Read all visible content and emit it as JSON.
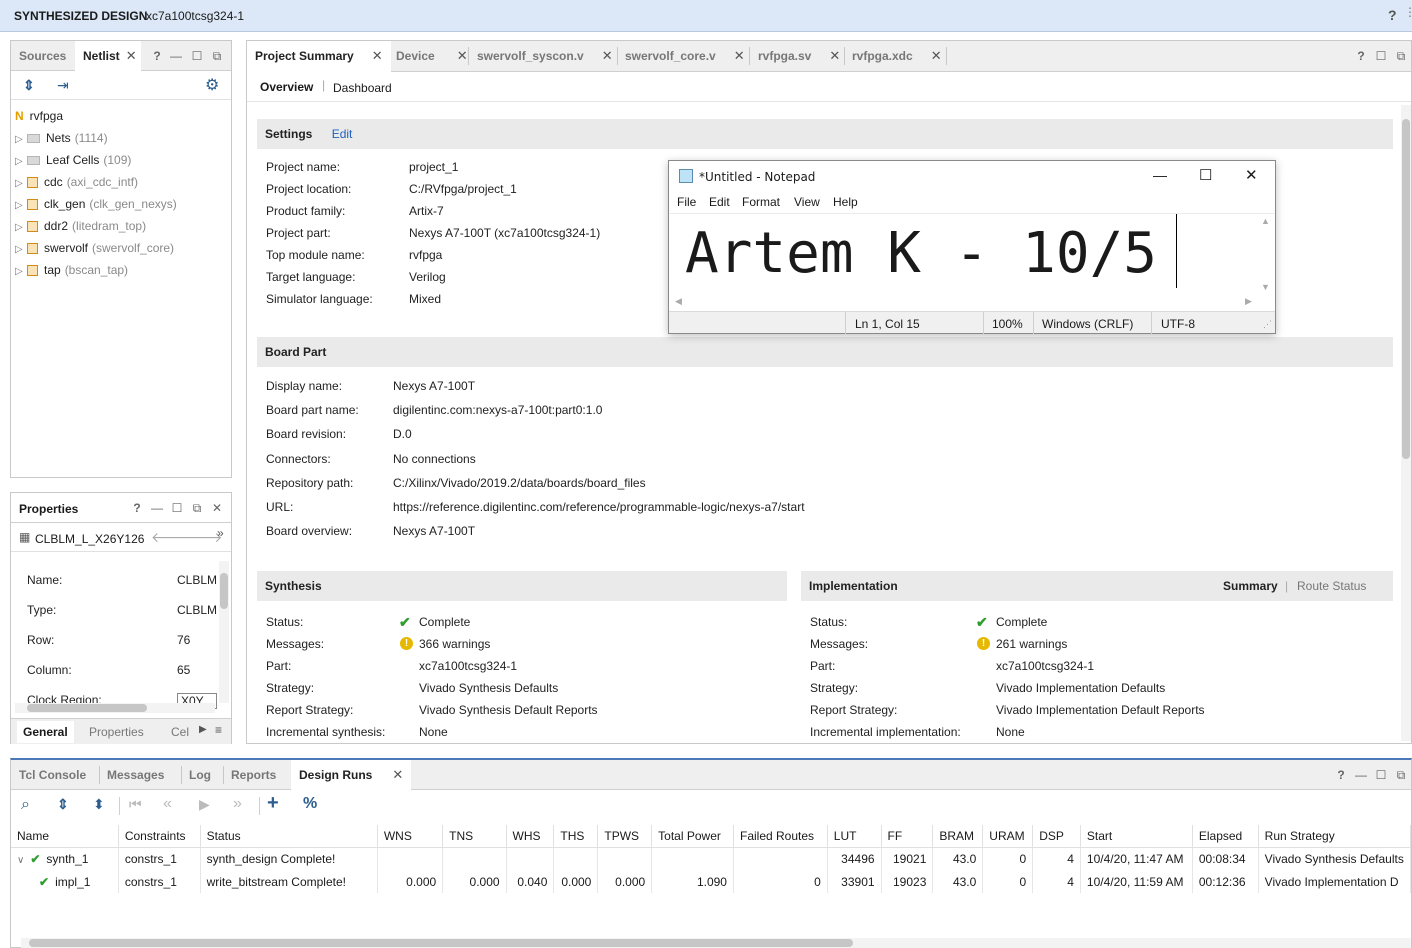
{
  "title_bar": {
    "title": "SYNTHESIZED DESIGN",
    "part": "xc7a100tcsg324-1",
    "help": "?"
  },
  "netlist_panel": {
    "tabs": [
      "Sources",
      "Netlist"
    ],
    "root": "rvfpga",
    "items": [
      {
        "name": "Nets",
        "extra": "(1114)",
        "kind": "folder"
      },
      {
        "name": "Leaf Cells",
        "extra": "(109)",
        "kind": "folder"
      },
      {
        "name": "cdc",
        "extra": "(axi_cdc_intf)",
        "kind": "cell"
      },
      {
        "name": "clk_gen",
        "extra": "(clk_gen_nexys)",
        "kind": "cell"
      },
      {
        "name": "ddr2",
        "extra": "(litedram_top)",
        "kind": "cell"
      },
      {
        "name": "swervolf",
        "extra": "(swervolf_core)",
        "kind": "cell"
      },
      {
        "name": "tap",
        "extra": "(bscan_tap)",
        "kind": "cell"
      }
    ]
  },
  "properties_panel": {
    "title": "Properties",
    "object": "CLBLM_L_X26Y126",
    "rows": [
      {
        "label": "Name:",
        "value": "CLBLM"
      },
      {
        "label": "Type:",
        "value": "CLBLM"
      },
      {
        "label": "Row:",
        "value": "76"
      },
      {
        "label": "Column:",
        "value": "65"
      },
      {
        "label": "Clock Region:",
        "value": "X0Y"
      }
    ],
    "bottom_tabs": [
      "General",
      "Properties",
      "Cel"
    ]
  },
  "editor_tabs": [
    "Project Summary",
    "Device",
    "swervolf_syscon.v",
    "swervolf_core.v",
    "rvfpga.sv",
    "rvfpga.xdc"
  ],
  "sub_tabs": {
    "overview": "Overview",
    "dashboard": "Dashboard"
  },
  "settings": {
    "header": "Settings",
    "edit": "Edit",
    "rows": [
      {
        "label": "Project name:",
        "value": "project_1",
        "link": false
      },
      {
        "label": "Project location:",
        "value": "C:/RVfpga/project_1",
        "link": false
      },
      {
        "label": "Product family:",
        "value": "Artix-7",
        "link": false
      },
      {
        "label": "Project part:",
        "value": "Nexys A7-100T (xc7a100tcsg324-1)",
        "link": true
      },
      {
        "label": "Top module name:",
        "value": "rvfpga",
        "link": true
      },
      {
        "label": "Target language:",
        "value": "Verilog",
        "link": true
      },
      {
        "label": "Simulator language:",
        "value": "Mixed",
        "link": true
      }
    ]
  },
  "board_part": {
    "header": "Board Part",
    "rows": [
      {
        "label": "Display name:",
        "value": "Nexys A7-100T",
        "link": false
      },
      {
        "label": "Board part name:",
        "value": "digilentinc.com:nexys-a7-100t:part0:1.0",
        "link": false
      },
      {
        "label": "Board revision:",
        "value": "D.0",
        "link": false
      },
      {
        "label": "Connectors:",
        "value": "No connections",
        "link": false
      },
      {
        "label": "Repository path:",
        "value": "C:/Xilinx/Vivado/2019.2/data/boards/board_files",
        "link": false
      },
      {
        "label": "URL:",
        "value": "https://reference.digilentinc.com/reference/programmable-logic/nexys-a7/start",
        "link": true
      },
      {
        "label": "Board overview:",
        "value": "Nexys A7-100T",
        "link": false
      }
    ]
  },
  "synthesis": {
    "header": "Synthesis",
    "rows": [
      {
        "label": "Status:",
        "value": "Complete",
        "icon": "check",
        "link": false
      },
      {
        "label": "Messages:",
        "value": "366 warnings",
        "icon": "warn",
        "link": true
      },
      {
        "label": "Part:",
        "value": "xc7a100tcsg324-1",
        "icon": "",
        "link": false
      },
      {
        "label": "Strategy:",
        "value": "Vivado Synthesis Defaults",
        "icon": "",
        "link": true
      },
      {
        "label": "Report Strategy:",
        "value": "Vivado Synthesis Default Reports",
        "icon": "",
        "link": true
      },
      {
        "label": "Incremental synthesis:",
        "value": "None",
        "icon": "",
        "link": true
      }
    ]
  },
  "implementation": {
    "header": "Implementation",
    "summary": "Summary",
    "route_status": "Route Status",
    "rows": [
      {
        "label": "Status:",
        "value": "Complete",
        "icon": "check",
        "link": false
      },
      {
        "label": "Messages:",
        "value": "261 warnings",
        "icon": "warn",
        "link": true
      },
      {
        "label": "Part:",
        "value": "xc7a100tcsg324-1",
        "icon": "",
        "link": false
      },
      {
        "label": "Strategy:",
        "value": "Vivado Implementation Defaults",
        "icon": "",
        "link": true
      },
      {
        "label": "Report Strategy:",
        "value": "Vivado Implementation Default Reports",
        "icon": "",
        "link": true
      },
      {
        "label": "Incremental implementation:",
        "value": "None",
        "icon": "",
        "link": true
      }
    ]
  },
  "notepad": {
    "title": "*Untitled - Notepad",
    "menu": [
      "File",
      "Edit",
      "Format",
      "View",
      "Help"
    ],
    "text": "Artem K - 10/5",
    "status": {
      "position": "Ln 1, Col 15",
      "zoom": "100%",
      "eol": "Windows (CRLF)",
      "encoding": "UTF-8"
    }
  },
  "bottom_tabs": [
    "Tcl Console",
    "Messages",
    "Log",
    "Reports",
    "Design Runs"
  ],
  "runs": {
    "columns": [
      "Name",
      "Constraints",
      "Status",
      "WNS",
      "TNS",
      "WHS",
      "THS",
      "TPWS",
      "Total Power",
      "Failed Routes",
      "LUT",
      "FF",
      "BRAM",
      "URAM",
      "DSP",
      "Start",
      "Elapsed",
      "Run Strategy"
    ],
    "rows": [
      [
        "synth_1",
        "constrs_1",
        "synth_design Complete!",
        "",
        "",
        "",
        "",
        "",
        "",
        "",
        "34496",
        "19021",
        "43.0",
        "0",
        "4",
        "10/4/20, 11:47 AM",
        "00:08:34",
        "Vivado Synthesis Defaults"
      ],
      [
        "impl_1",
        "constrs_1",
        "write_bitstream Complete!",
        "0.000",
        "0.000",
        "0.040",
        "0.000",
        "0.000",
        "1.090",
        "0",
        "33901",
        "19023",
        "43.0",
        "0",
        "4",
        "10/4/20, 11:59 AM",
        "00:12:36",
        "Vivado Implementation D"
      ]
    ]
  }
}
